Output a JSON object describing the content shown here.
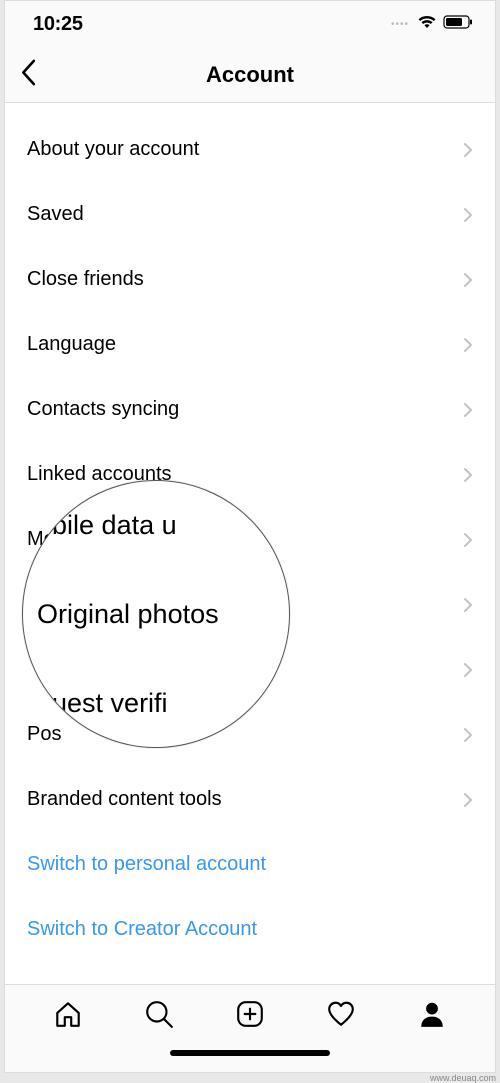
{
  "status": {
    "time": "10:25"
  },
  "header": {
    "title": "Account"
  },
  "rows": [
    {
      "label": "About your account"
    },
    {
      "label": "Saved"
    },
    {
      "label": "Close friends"
    },
    {
      "label": "Language"
    },
    {
      "label": "Contacts syncing"
    },
    {
      "label": "Linked accounts"
    },
    {
      "label": "Mobile"
    },
    {
      "label": ""
    },
    {
      "label": ""
    },
    {
      "label": "Pos"
    },
    {
      "label": "Branded content tools"
    }
  ],
  "links": [
    {
      "label": "Switch to personal account"
    },
    {
      "label": "Switch to Creator Account"
    }
  ],
  "magnifier": {
    "line1": "obile data u",
    "line2": "Original photos",
    "line3": "quest verifi"
  },
  "watermark": "www.deuaq.com"
}
